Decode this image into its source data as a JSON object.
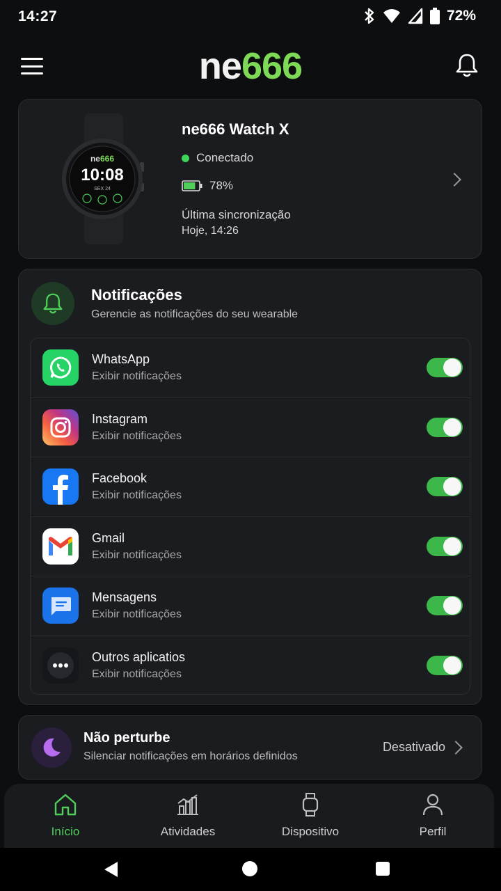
{
  "status_bar": {
    "time": "14:27",
    "battery_pct": "72%"
  },
  "header": {
    "logo_part1": "ne",
    "logo_part2": "666"
  },
  "device": {
    "name": "ne666 Watch X",
    "status": "Conectado",
    "battery": "78%",
    "battery_level": 0.78,
    "sync_label": "Última sincronização",
    "sync_time": "Hoje, 14:26",
    "watch_face": {
      "brand1": "ne",
      "brand2": "666",
      "time": "10:08",
      "date": "SEX 24"
    }
  },
  "notifications": {
    "title": "Notificações",
    "subtitle": "Gerencie as notificações do seu wearable",
    "apps": [
      {
        "name": "WhatsApp",
        "sub": "Exibir notificações",
        "enabled": true,
        "icon": "whatsapp-icon"
      },
      {
        "name": "Instagram",
        "sub": "Exibir notificações",
        "enabled": true,
        "icon": "instagram-icon"
      },
      {
        "name": "Facebook",
        "sub": "Exibir notificações",
        "enabled": true,
        "icon": "facebook-icon"
      },
      {
        "name": "Gmail",
        "sub": "Exibir notificações",
        "enabled": true,
        "icon": "gmail-icon"
      },
      {
        "name": "Mensagens",
        "sub": "Exibir notificações",
        "enabled": true,
        "icon": "messages-icon"
      },
      {
        "name": "Outros aplicatios",
        "sub": "Exibir notificações",
        "enabled": true,
        "icon": "more-apps-icon"
      }
    ]
  },
  "dnd": {
    "title": "Não perturbe",
    "subtitle": "Silenciar notificações em horários definidos",
    "state": "Desativado"
  },
  "bottom_nav": [
    {
      "label": "Início",
      "icon": "home-icon",
      "active": true
    },
    {
      "label": "Atividades",
      "icon": "activities-icon",
      "active": false
    },
    {
      "label": "Dispositivo",
      "icon": "watch-icon",
      "active": false
    },
    {
      "label": "Perfil",
      "icon": "profile-icon",
      "active": false
    }
  ],
  "colors": {
    "accent": "#4fcf5a",
    "logo_green": "#7ed957",
    "background": "#0d0e10",
    "card": "#1b1c1f"
  }
}
